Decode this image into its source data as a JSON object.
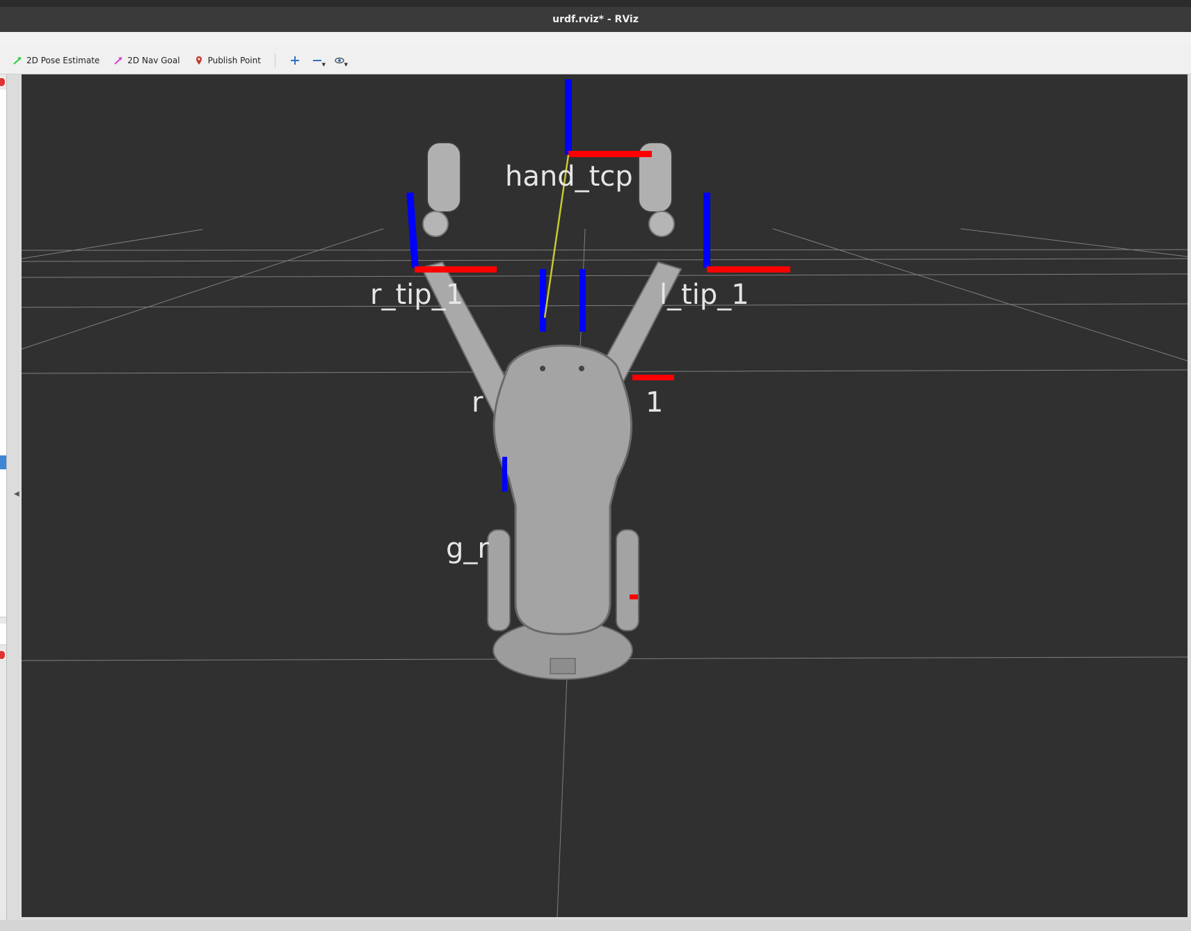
{
  "window": {
    "title": "urdf.rviz* - RViz"
  },
  "toolbar": {
    "pose_estimate": "2D Pose Estimate",
    "nav_goal": "2D Nav Goal",
    "publish_point": "Publish Point"
  },
  "viewport": {
    "labels": {
      "hand_tcp": "hand_tcp",
      "r_tip_1": "r_tip_1",
      "l_tip_1": "l_tip_1",
      "r_partial": "r",
      "one_partial": "1",
      "g_r_partial": "g_r"
    },
    "colors": {
      "background": "#303030",
      "axis_x": "#ff0000",
      "axis_z": "#0000ff",
      "link_line": "#c8c832",
      "grid": "#a0a0a0",
      "robot": "#a6a6a6"
    }
  }
}
